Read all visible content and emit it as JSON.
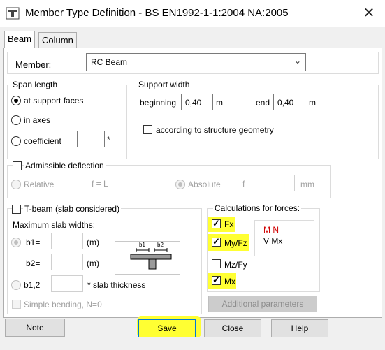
{
  "window": {
    "title": "Member Type Definition - BS EN1992-1-1:2004 NA:2005"
  },
  "tabs": [
    {
      "label": "Beam"
    },
    {
      "label": "Column"
    }
  ],
  "member": {
    "label": "Member:",
    "value": "RC Beam"
  },
  "span_length": {
    "title": "Span length",
    "options": [
      {
        "label": "at support faces",
        "selected": true
      },
      {
        "label": "in axes",
        "selected": false
      },
      {
        "label": "coefficient",
        "selected": false
      }
    ],
    "coefficient_value": "",
    "asterisk": "*"
  },
  "support_width": {
    "title": "Support width",
    "beginning_label": "beginning",
    "beginning_value": "0,40",
    "end_label": "end",
    "end_value": "0,40",
    "unit": "m",
    "geometry_label": "according to structure geometry",
    "geometry_checked": false
  },
  "deflection": {
    "label": "Admissible deflection",
    "checked": false,
    "relative_label": "Relative",
    "f_eq_l": "f = L",
    "absolute_label": "Absolute",
    "f_label": "f",
    "unit": "mm"
  },
  "tbeam": {
    "label": "T-beam (slab considered)",
    "checked": false,
    "max_widths_label": "Maximum slab widths:",
    "b1_label": "b1=",
    "b2_label": "b2=",
    "b12_label": "b1,2=",
    "unit_m": "(m)",
    "slab_thickness": "* slab thickness",
    "simple_bending": "Simple bending, N=0",
    "diagram_b1": "b1",
    "diagram_b2": "b2"
  },
  "forces": {
    "title": "Calculations for forces:",
    "items": [
      {
        "label": "Fx",
        "checked": true
      },
      {
        "label": "My/Fz",
        "checked": true
      },
      {
        "label": "Mz/Fy",
        "checked": false
      },
      {
        "label": "Mx",
        "checked": true
      }
    ],
    "legend_line1": "M N",
    "legend_line2": "V Mx",
    "legend_color": "#d00000",
    "additional_params": "Additional parameters"
  },
  "buttons": {
    "note": "Note",
    "save": "Save",
    "close": "Close",
    "help": "Help"
  },
  "colors": {
    "highlight": "#ffff33",
    "accent": "#0078d7"
  }
}
